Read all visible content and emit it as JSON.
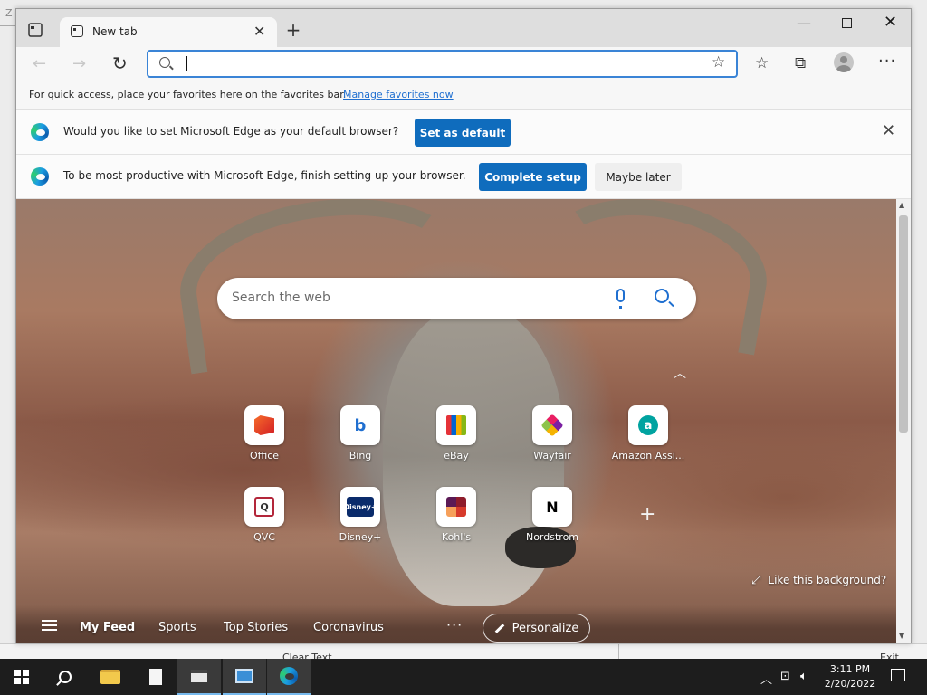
{
  "desktop": {
    "corner_text": "Z",
    "bottom_left_text": "Clear Text",
    "bottom_right_text": "Exit"
  },
  "browser": {
    "tab": {
      "title": "New tab"
    },
    "favorites_bar": {
      "message": "For quick access, place your favorites here on the favorites bar.",
      "link": "Manage favorites now"
    },
    "infobars": [
      {
        "message": "Would you like to set Microsoft Edge as your default browser?",
        "button": "Set as default"
      },
      {
        "message": "To be most productive with Microsoft Edge, finish setting up your browser.",
        "primary_button": "Complete setup",
        "secondary_button": "Maybe later"
      }
    ]
  },
  "new_tab_page": {
    "search_placeholder": "Search the web",
    "quick_links": [
      {
        "label": "Office",
        "icon": "office-icon"
      },
      {
        "label": "Bing",
        "icon": "bing-icon",
        "glyph": "b"
      },
      {
        "label": "eBay",
        "icon": "ebay-icon"
      },
      {
        "label": "Wayfair",
        "icon": "wayfair-icon"
      },
      {
        "label": "Amazon Assi...",
        "icon": "amazon-icon",
        "glyph": "a"
      },
      {
        "label": "QVC",
        "icon": "qvc-icon",
        "glyph": "Q"
      },
      {
        "label": "Disney+",
        "icon": "disney-icon",
        "glyph": "Disney+"
      },
      {
        "label": "Kohl's",
        "icon": "kohls-icon"
      },
      {
        "label": "Nordstrom",
        "icon": "nordstrom-icon",
        "glyph": "N"
      }
    ],
    "background_link": "Like this background?",
    "feed": {
      "tabs": [
        "My Feed",
        "Sports",
        "Top Stories",
        "Coronavirus"
      ],
      "personalize": "Personalize"
    }
  },
  "taskbar": {
    "time": "3:11 PM",
    "date": "2/20/2022"
  },
  "colors": {
    "accent": "#0f6cbd",
    "link": "#1f6fd0",
    "taskbar": "#1d1d1d"
  }
}
